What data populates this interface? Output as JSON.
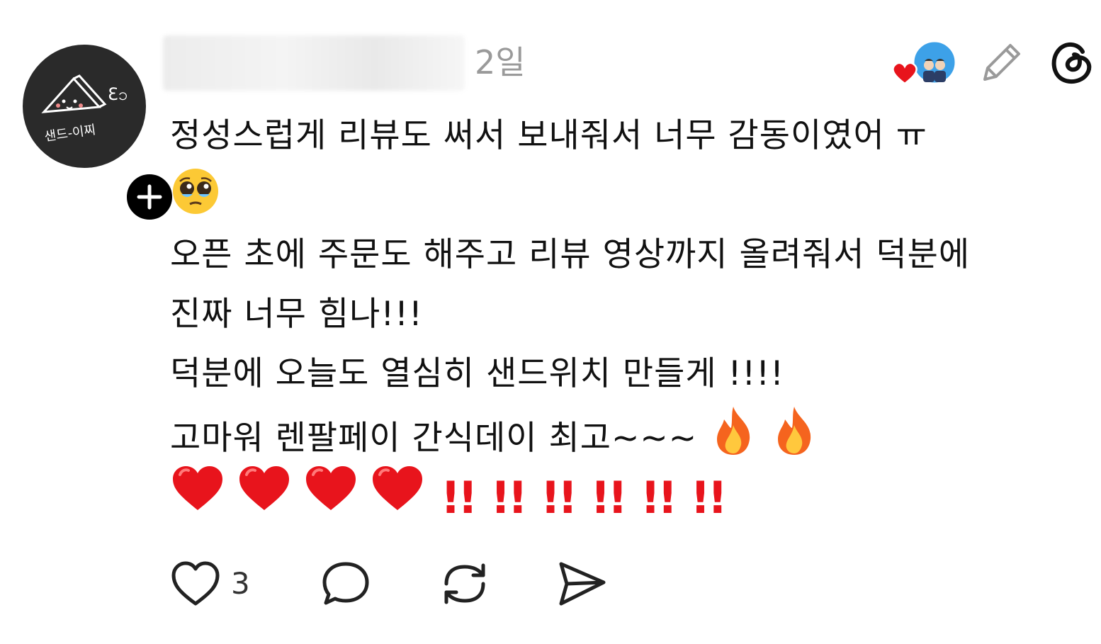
{
  "post": {
    "time": "2일",
    "lines": [
      "정성스럽게 리뷰도 써서 보내줘서 너무 감동이였어 ㅠ",
      "",
      "오픈 초에 주문도 해주고 리뷰 영상까지 올려줘서 덕분에",
      "진짜 너무 힘나!!!",
      "덕분에 오늘도 열심히 샌드위치 만들게 !!!!",
      "고마워 렌팔페이 간식데이 최고~~~"
    ],
    "bangs": [
      "!!",
      "!!",
      "!!",
      "!!",
      "!!",
      "!!"
    ],
    "avatar_text": "샌드-이찌"
  },
  "actions": {
    "like_count": "3",
    "icons": [
      "heart-outline-icon",
      "comment-icon",
      "repost-icon",
      "share-icon"
    ]
  },
  "header": {
    "icons": [
      "liked-by-author-icon",
      "edit-pencil-icon",
      "threads-logo-icon"
    ]
  },
  "colors": {
    "heart": "#e8141c",
    "time": "#9a9a9a",
    "avatar_bg": "#2a2a2a",
    "liked_avatar_bg": "#3da1e8"
  }
}
